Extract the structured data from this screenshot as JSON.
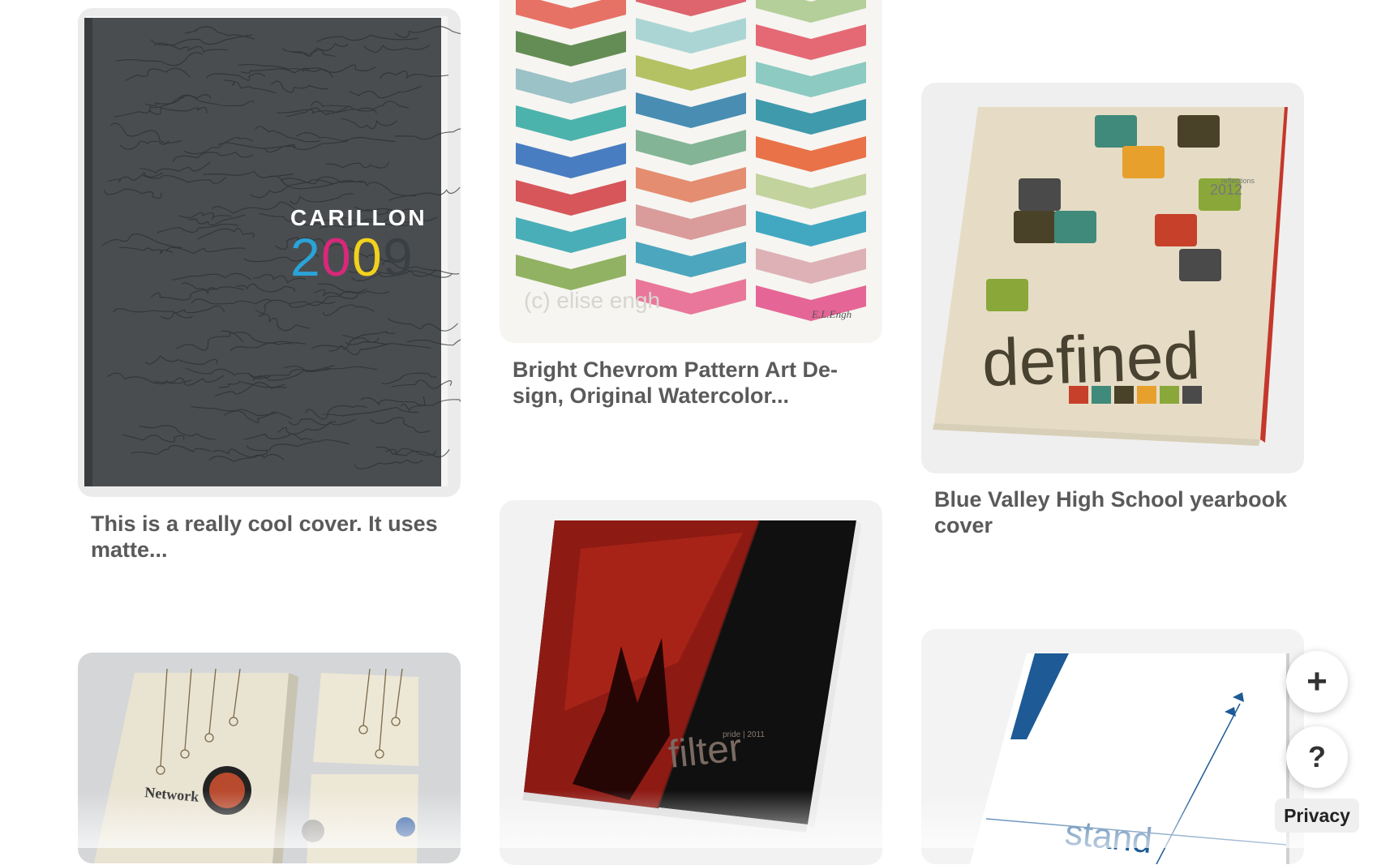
{
  "pins": [
    {
      "id": "carillon",
      "title": "This is a really cool cover. It uses matte...",
      "cover_text": "CARILLON",
      "year_digits": [
        "2",
        "0",
        "0",
        "9"
      ]
    },
    {
      "id": "chevron",
      "title": "Bright Chevrom Pattern Art De-sign, Original Watercolor...",
      "watermark": "(c) elise engh",
      "signature": "E.L.Engh"
    },
    {
      "id": "defined",
      "title": "Blue Valley High School yearbook cover",
      "cover_word": "defined",
      "cover_small": "reflections",
      "cover_year": "2012"
    },
    {
      "id": "network",
      "title": "",
      "cover_word": "Network"
    },
    {
      "id": "filter",
      "title": "",
      "cover_word": "filter",
      "cover_small": "pride | 2011"
    },
    {
      "id": "stand",
      "title": "",
      "cover_word": "stand"
    }
  ],
  "controls": {
    "add_label": "+",
    "help_label": "?",
    "privacy_label": "Privacy"
  },
  "colors": {
    "title_text": "#5a5a5a",
    "carillon_cover": "#4a4d50",
    "digit_colors": [
      "#2aa3d8",
      "#d8287a",
      "#f2d21c",
      "#3a3f44"
    ]
  }
}
